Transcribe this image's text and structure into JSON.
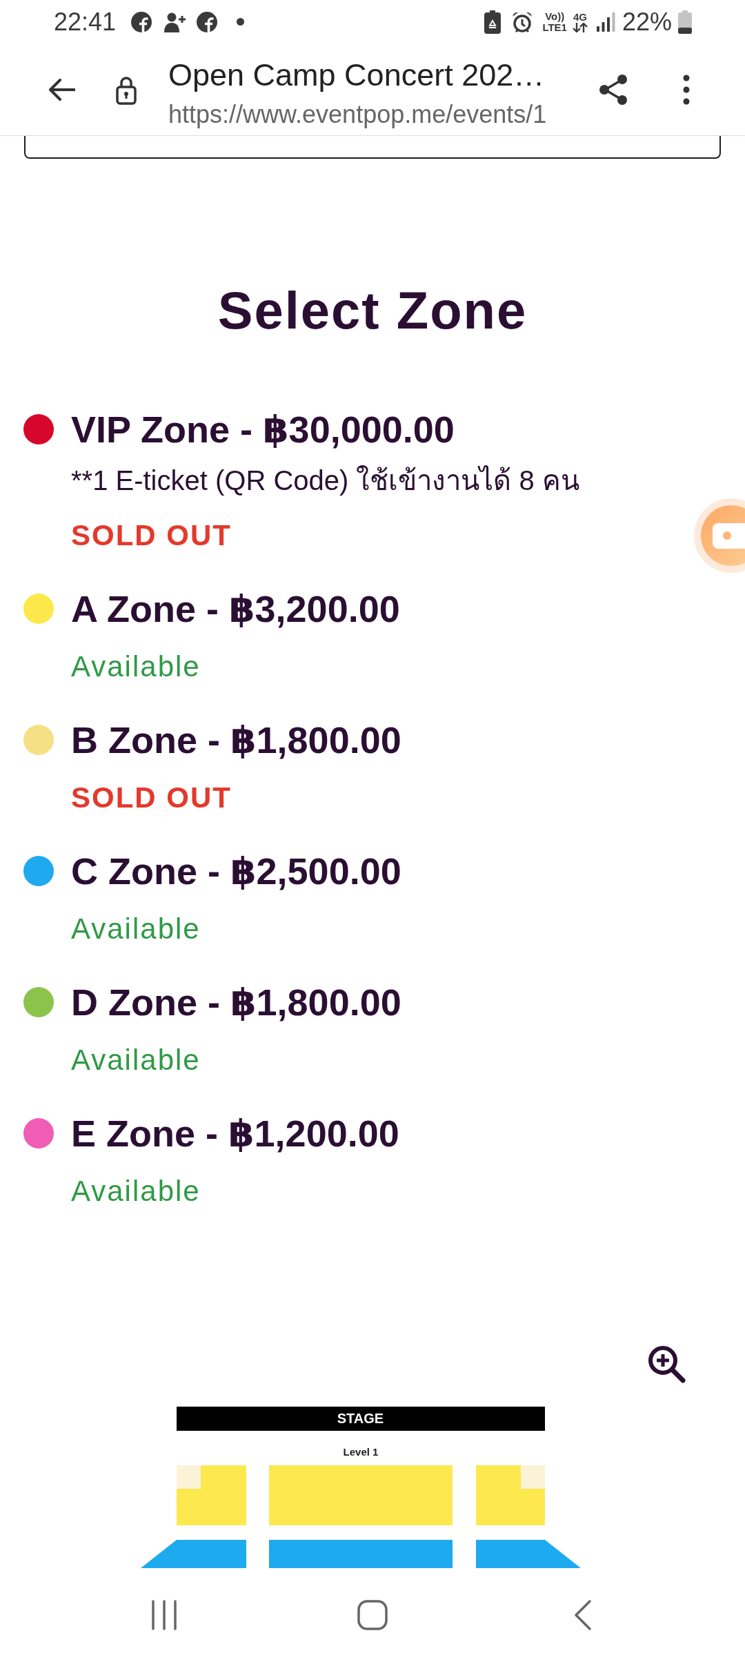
{
  "status_bar": {
    "time": "22:41",
    "volte_label": "Vo))",
    "lte_label": "LTE1",
    "network_type": "4G",
    "battery_percent": "22%"
  },
  "browser_bar": {
    "title": "Open Camp Concert 202…",
    "url": "https://www.eventpop.me/events/1"
  },
  "heading": "Select Zone",
  "zones": [
    {
      "name": "VIP Zone - ฿30,000.00",
      "color": "#d7062b",
      "note": "**1 E-ticket (QR Code) ใช้เข้างานได้ 8 คน",
      "status": "SOLD OUT",
      "sold_out": true
    },
    {
      "name": "A Zone - ฿3,200.00",
      "color": "#fde84c",
      "status": "Available",
      "sold_out": false
    },
    {
      "name": "B Zone - ฿1,800.00",
      "color": "#f6e085",
      "status": "SOLD OUT",
      "sold_out": true
    },
    {
      "name": "C Zone - ฿2,500.00",
      "color": "#1fa9ef",
      "status": "Available",
      "sold_out": false
    },
    {
      "name": "D Zone - ฿1,800.00",
      "color": "#8cc34b",
      "status": "Available",
      "sold_out": false
    },
    {
      "name": "E Zone - ฿1,200.00",
      "color": "#f05db4",
      "status": "Available",
      "sold_out": false
    }
  ],
  "seat_map": {
    "stage_label": "STAGE",
    "level_label": "Level 1",
    "sections": [
      {
        "color": "#fde84f"
      },
      {
        "color": "#faf3d7"
      },
      {
        "color": "#fde84f"
      },
      {
        "color": "#fde84f"
      },
      {
        "color": "#faf3d7"
      },
      {
        "color": "#1eaaee"
      },
      {
        "color": "#1eaaee"
      },
      {
        "color": "#1eaaee"
      }
    ]
  }
}
